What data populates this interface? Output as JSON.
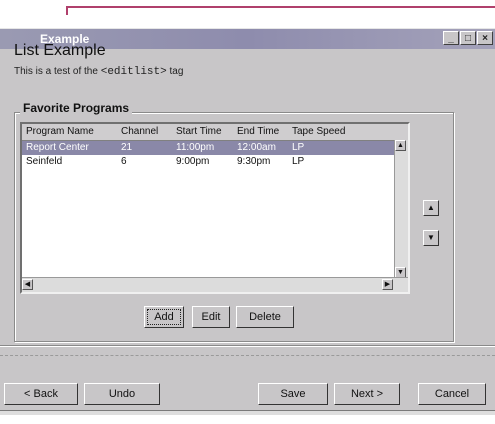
{
  "window": {
    "title": "Example",
    "controls": {
      "minimize": "_",
      "maximize": "□",
      "close": "×"
    }
  },
  "page": {
    "heading": "List Example",
    "subheading_prefix": "This is a test of the ",
    "subheading_code": "<editlist>",
    "subheading_suffix": " tag"
  },
  "group": {
    "label": "Favorite Programs"
  },
  "list": {
    "columns": [
      "Program Name",
      "Channel",
      "Start Time",
      "End Time",
      "Tape Speed"
    ],
    "rows": [
      {
        "program": "Report Center",
        "channel": "21",
        "start": "11:00pm",
        "end": "12:00am",
        "speed": "LP",
        "selected": true
      },
      {
        "program": "Seinfeld",
        "channel": "6",
        "start": "9:00pm",
        "end": "9:30pm",
        "speed": "LP",
        "selected": false
      }
    ]
  },
  "actions": {
    "add": "Add",
    "edit": "Edit",
    "delete": "Delete",
    "move_up_icon": "up-arrow-icon",
    "move_down_icon": "down-arrow-icon"
  },
  "footer": {
    "back": "< Back",
    "undo": "Undo",
    "save": "Save",
    "next": "Next >",
    "cancel": "Cancel"
  },
  "colors": {
    "titlebar": "#9a9ab2",
    "selection": "#8a88a8",
    "dialog": "#c8c6c8",
    "accent_line": "#b0406c"
  }
}
